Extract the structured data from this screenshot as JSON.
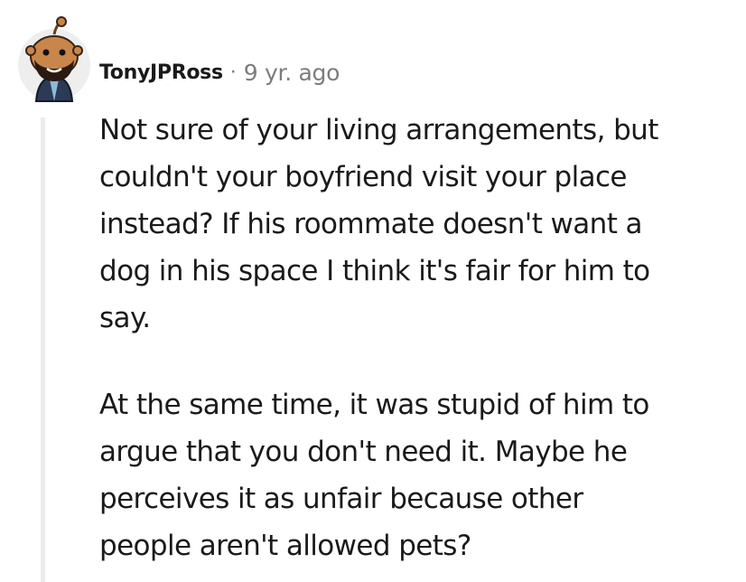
{
  "comment": {
    "username": "TonyJPRoss",
    "separator": "·",
    "timestamp": "9 yr. ago",
    "avatar_icon": "snoo-avatar-icon",
    "paragraphs": [
      "Not sure of your living arrangements, but\ncouldn't your boyfriend visit your place\ninstead? If his roommate doesn't want a\ndog in his space I think it's fair for him to\nsay.",
      "At the same time, it was stupid of him to\nargue that you don't need it. Maybe he\nperceives it as unfair because other\npeople aren't allowed pets?"
    ]
  },
  "colors": {
    "text": "#1a1a1b",
    "meta": "#7c7c7c",
    "thread_line": "#ececec",
    "avatar_bg": "#eeeeee",
    "avatar_skin": "#c8864b"
  }
}
